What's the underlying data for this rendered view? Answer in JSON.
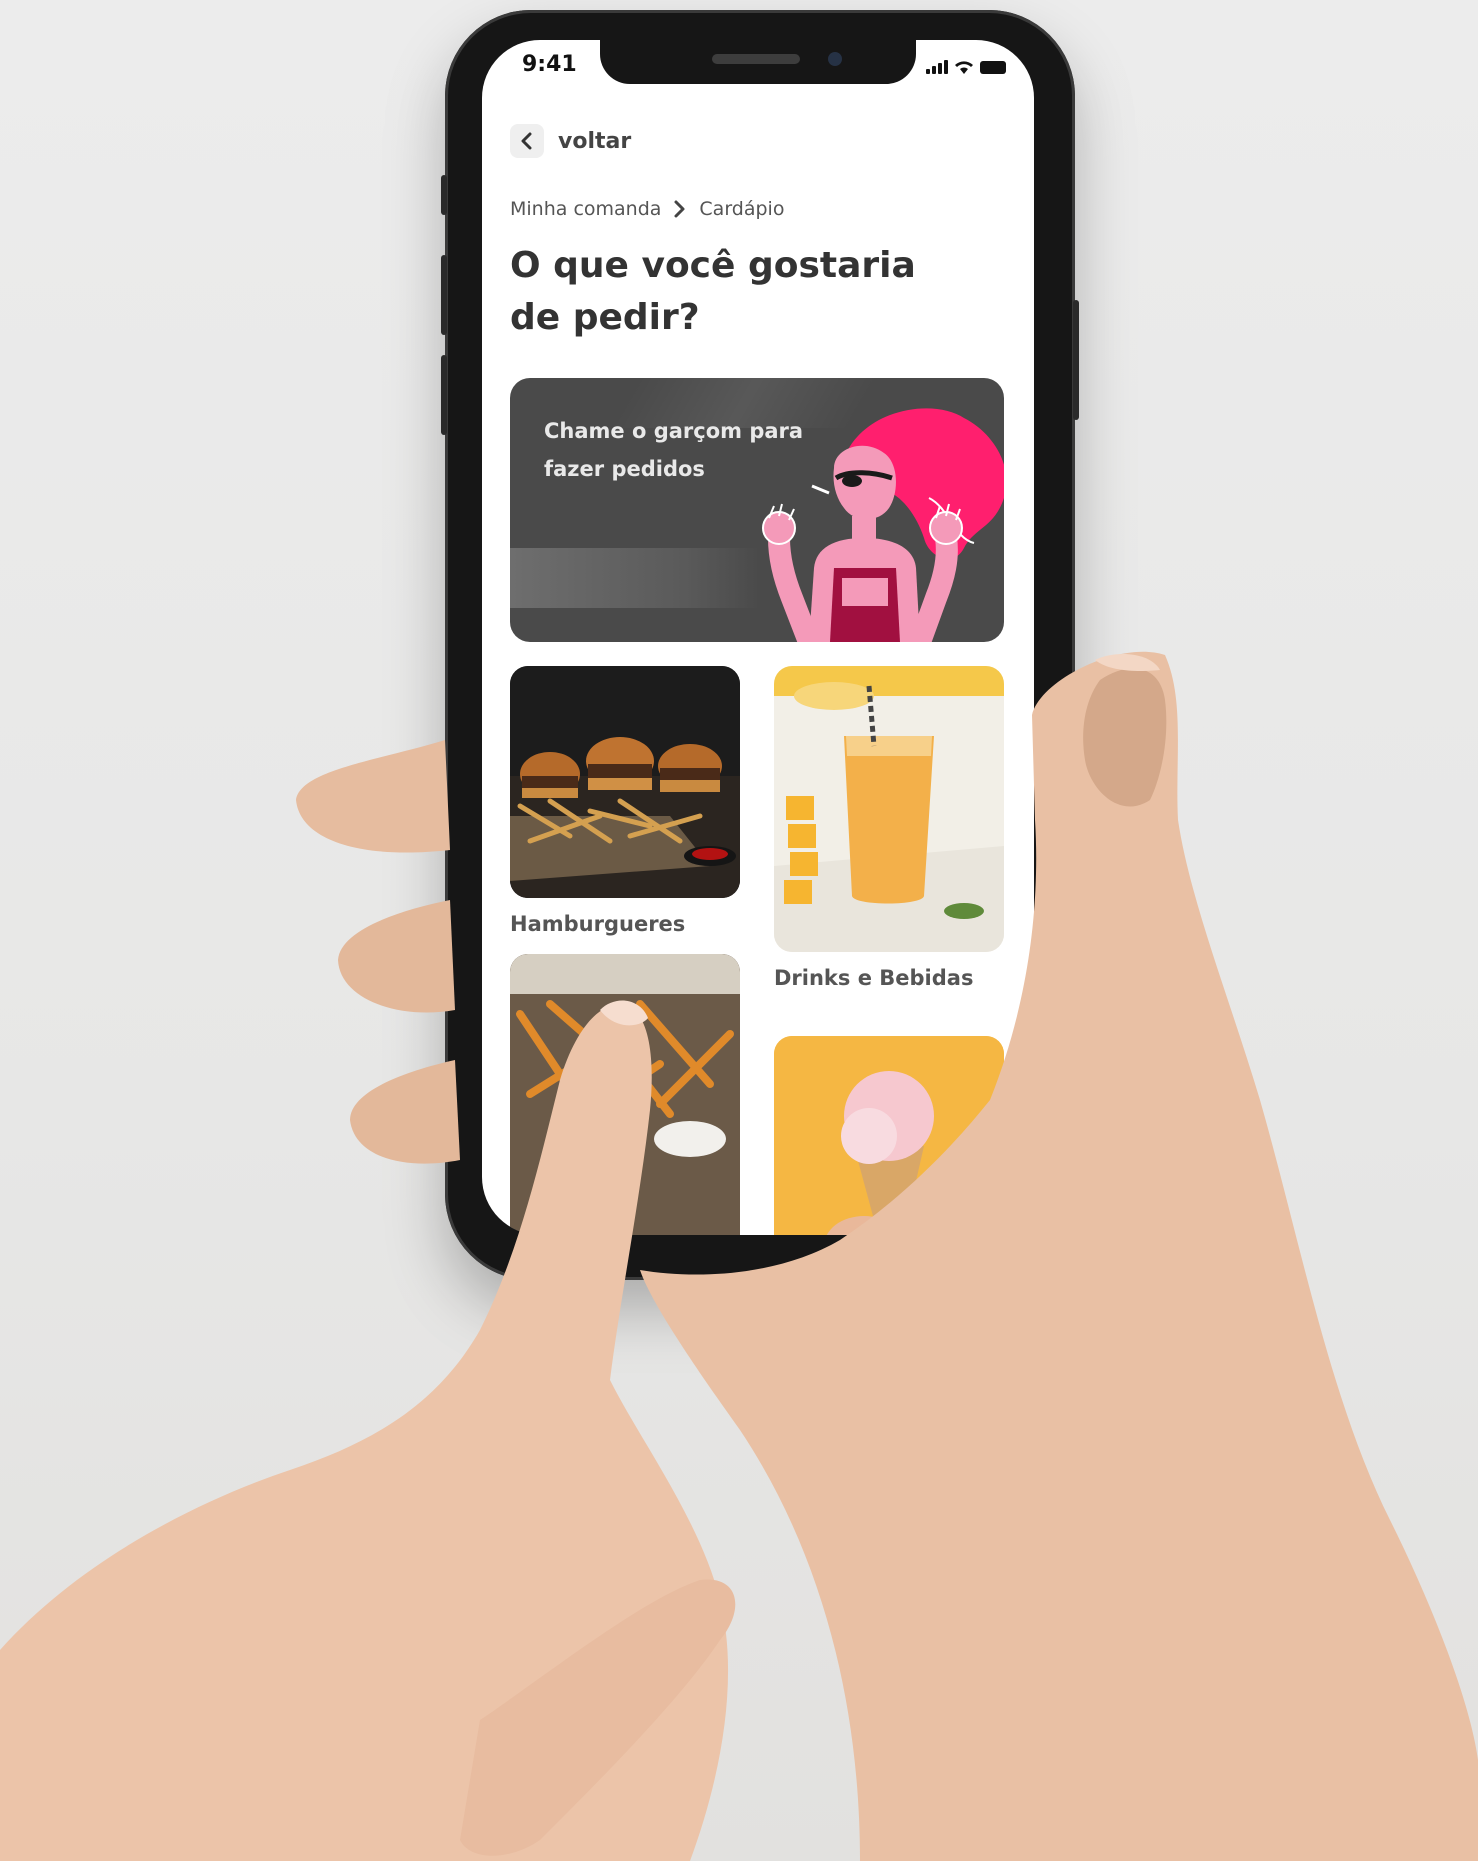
{
  "status_bar": {
    "time": "9:41"
  },
  "nav": {
    "back_label": "voltar"
  },
  "breadcrumb": {
    "items": [
      "Minha comanda",
      "Cardápio"
    ]
  },
  "page": {
    "title": "O que você gostaria de pedir?"
  },
  "banner": {
    "text": "Chame o garçom para fazer pedidos"
  },
  "categories": [
    {
      "label": "Hamburgueres",
      "image": "burgers-photo"
    },
    {
      "label": "Drinks e Bebidas",
      "image": "juice-photo"
    },
    {
      "label": "",
      "image": "fries-photo"
    },
    {
      "label": "",
      "image": "ice-cream-photo"
    }
  ],
  "colors": {
    "banner_bg": "#4a4a4a",
    "accent_pink": "#ff1f6e",
    "illustration_pink": "#f49ab9",
    "text_dark": "#333333"
  }
}
